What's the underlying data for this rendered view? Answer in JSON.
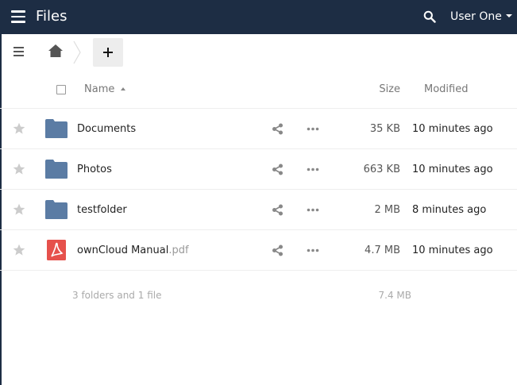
{
  "header": {
    "menu_icon": "hamburger-menu-icon",
    "app_title": "Files",
    "search_icon": "search-icon",
    "user_name": "User One",
    "background_color": "#1d2d44"
  },
  "controls": {
    "nav_toggle_icon": "hamburger-menu-icon",
    "breadcrumb_home_icon": "home-icon",
    "new_button_icon": "plus-icon"
  },
  "table": {
    "columns": {
      "name": "Name",
      "size": "Size",
      "modified": "Modified"
    },
    "sort": {
      "column": "name",
      "direction": "ascending"
    },
    "rows": [
      {
        "name": "Documents",
        "extension": "",
        "type": "folder",
        "size": "35 KB",
        "modified": "10 minutes ago"
      },
      {
        "name": "Photos",
        "extension": "",
        "type": "folder",
        "size": "663 KB",
        "modified": "10 minutes ago"
      },
      {
        "name": "testfolder",
        "extension": "",
        "type": "folder",
        "size": "2 MB",
        "modified": "8 minutes ago"
      },
      {
        "name": "ownCloud Manual",
        "extension": ".pdf",
        "type": "pdf",
        "size": "4.7 MB",
        "modified": "10 minutes ago"
      }
    ],
    "summary": {
      "text": "3 folders and 1 file",
      "total_size": "7.4 MB"
    }
  },
  "colors": {
    "folder": "#5b7ca4",
    "pdf": "#e6514c",
    "star": "#cccccc"
  }
}
